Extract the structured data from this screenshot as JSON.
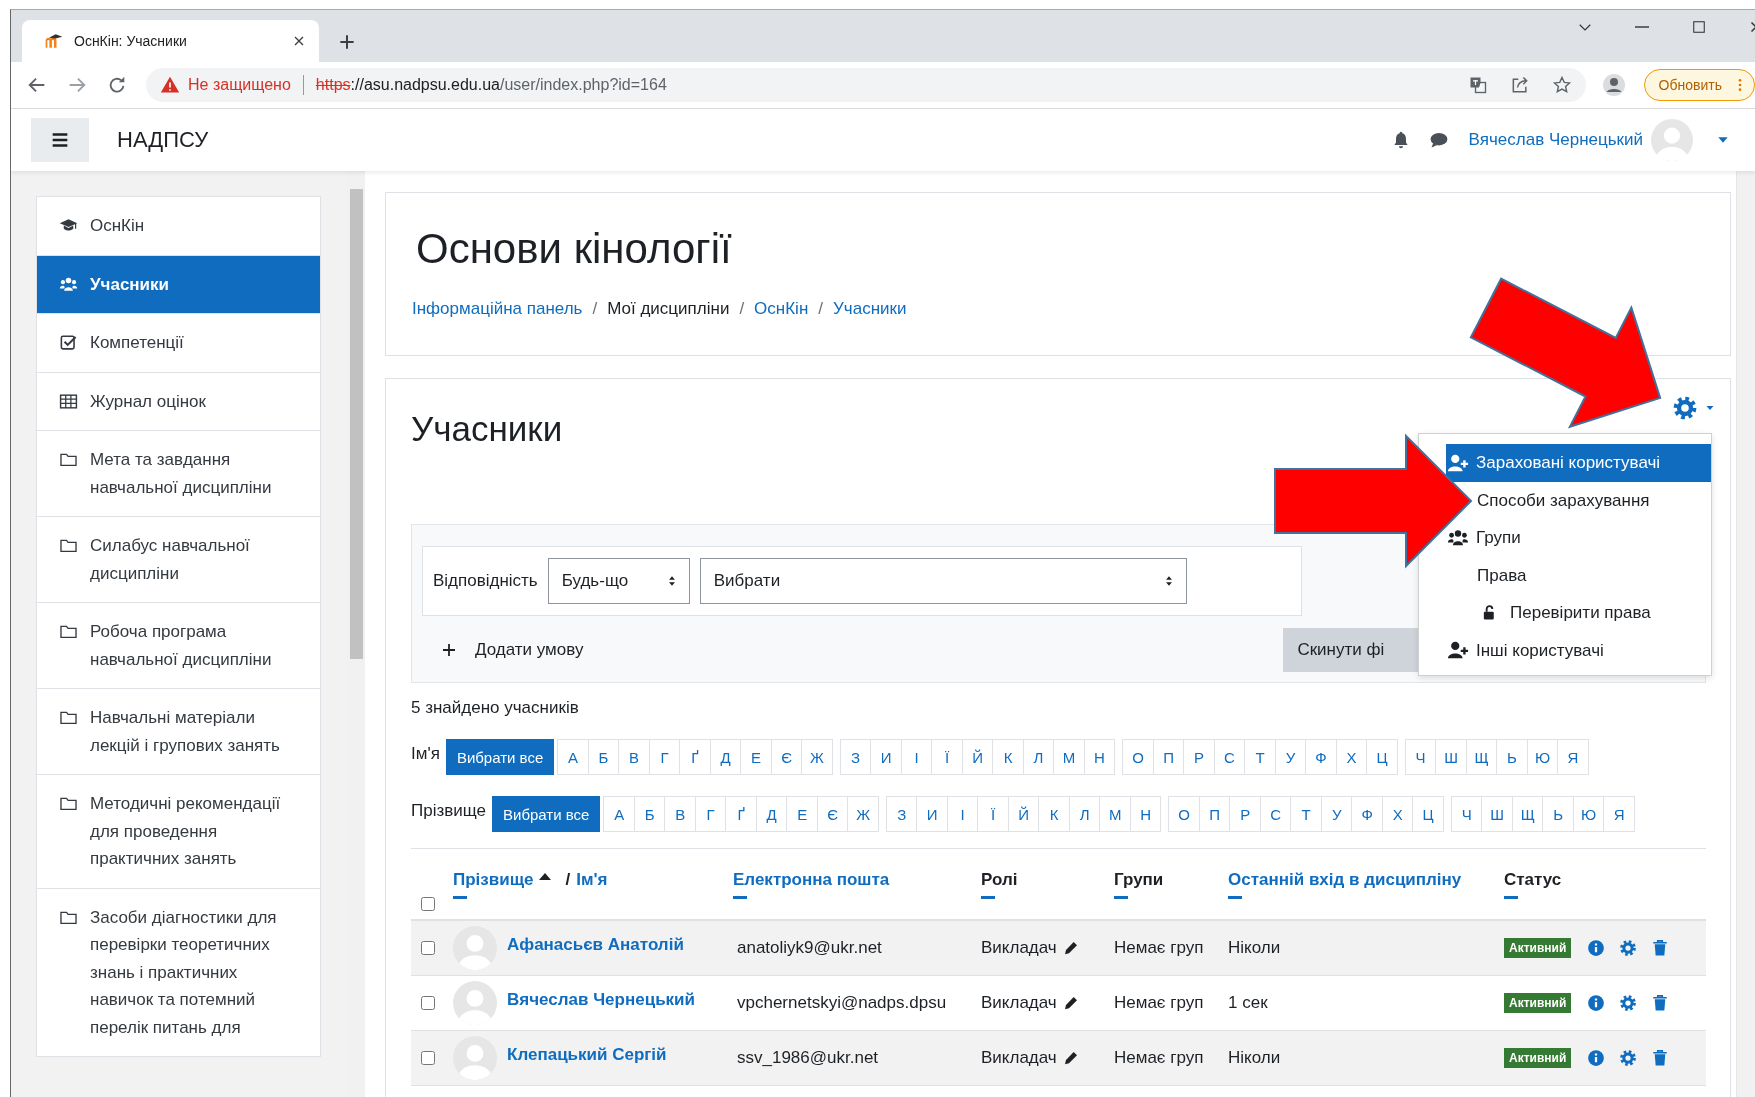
{
  "browser": {
    "tab_title": "ОснКін: Учасники",
    "address": {
      "warning": "Не защищено",
      "scheme": "https",
      "host": "://asu.nadpsu.edu.ua",
      "path": "/user/index.php?id=164"
    },
    "update_button": "Обновить"
  },
  "navbar": {
    "site_name": "НАДПСУ",
    "user_name": "Вячеслав Чернецький"
  },
  "sidebar": {
    "items": [
      {
        "label": "ОснКін",
        "kind": "course",
        "selected": false
      },
      {
        "label": "Учасники",
        "kind": "users",
        "selected": true
      },
      {
        "label": "Компетенції",
        "kind": "check",
        "selected": false
      },
      {
        "label": "Журнал оцінок",
        "kind": "table",
        "selected": false
      },
      {
        "label": "Мета та завдання навчальної дисципліни",
        "kind": "folder",
        "selected": false
      },
      {
        "label": "Силабус навчальної дисципліни",
        "kind": "folder",
        "selected": false
      },
      {
        "label": "Робоча програма навчальної дисципліни",
        "kind": "folder",
        "selected": false
      },
      {
        "label": "Навчальні матеріали лекцій і групових занять",
        "kind": "folder",
        "selected": false
      },
      {
        "label": "Методичні рекомендації для проведення практичних занять",
        "kind": "folder",
        "selected": false
      },
      {
        "label": "Засоби діагностики для перевірки теоретичних знань і практичних навичок та потемний перелік питань для",
        "kind": "folder",
        "selected": false
      }
    ]
  },
  "header": {
    "title": "Основи кінології",
    "breadcrumb": [
      {
        "label": "Інформаційна панель",
        "link": true
      },
      {
        "label": "Мої дисципліни",
        "link": false,
        "separator": "/"
      },
      {
        "label": "ОснКін",
        "link": true,
        "separator": "/"
      },
      {
        "label": "Учасники",
        "link": true,
        "separator": "/"
      }
    ]
  },
  "participants": {
    "heading": "Учасники",
    "settings_menu": {
      "expanded": true,
      "items": [
        {
          "label": "Зараховані користувачі",
          "kind": "adduser",
          "selected": true
        },
        {
          "label": "Способи зарахування",
          "kind": "none",
          "selected": false
        },
        {
          "label": "Групи",
          "kind": "group",
          "selected": false
        },
        {
          "label": "Права",
          "kind": "none",
          "selected": false
        },
        {
          "label": "Перевірити права",
          "kind": "lock",
          "selected": false
        },
        {
          "label": "Інші користувачі",
          "kind": "adduser",
          "selected": false
        }
      ]
    },
    "filter": {
      "match_label": "Відповідність",
      "match_value": "Будь-що",
      "condition_value": "Вибрати",
      "add_condition": "Додати умову",
      "reset_button": "Скинути фі"
    },
    "count_text": "5 знайдено учасників",
    "initials": [
      {
        "label": "Ім'я",
        "all": {
          "label": "Вибрати все",
          "selected": true
        },
        "letter_groups": [
          [
            {
              "label": "А",
              "selected": false
            },
            {
              "label": "Б",
              "selected": false
            },
            {
              "label": "В",
              "selected": false
            },
            {
              "label": "Г",
              "selected": false
            },
            {
              "label": "Ґ",
              "selected": false
            },
            {
              "label": "Д",
              "selected": false
            },
            {
              "label": "Е",
              "selected": false
            },
            {
              "label": "Є",
              "selected": false
            },
            {
              "label": "Ж",
              "selected": false
            }
          ],
          [
            {
              "label": "З",
              "selected": false
            },
            {
              "label": "И",
              "selected": false
            },
            {
              "label": "І",
              "selected": false
            },
            {
              "label": "Ї",
              "selected": false
            },
            {
              "label": "Й",
              "selected": false
            },
            {
              "label": "К",
              "selected": false
            },
            {
              "label": "Л",
              "selected": false
            },
            {
              "label": "М",
              "selected": false
            },
            {
              "label": "Н",
              "selected": false
            }
          ],
          [
            {
              "label": "О",
              "selected": false
            },
            {
              "label": "П",
              "selected": false
            },
            {
              "label": "Р",
              "selected": false
            },
            {
              "label": "С",
              "selected": false
            },
            {
              "label": "Т",
              "selected": false
            },
            {
              "label": "У",
              "selected": false
            },
            {
              "label": "Ф",
              "selected": false
            },
            {
              "label": "Х",
              "selected": false
            },
            {
              "label": "Ц",
              "selected": false
            }
          ],
          [
            {
              "label": "Ч",
              "selected": false
            },
            {
              "label": "Ш",
              "selected": false
            },
            {
              "label": "Щ",
              "selected": false
            },
            {
              "label": "Ь",
              "selected": false
            },
            {
              "label": "Ю",
              "selected": false
            },
            {
              "label": "Я",
              "selected": false
            }
          ]
        ]
      },
      {
        "label": "Прізвище",
        "all": {
          "label": "Вибрати все",
          "selected": true
        },
        "letter_groups": [
          [
            {
              "label": "А",
              "selected": false
            },
            {
              "label": "Б",
              "selected": false
            },
            {
              "label": "В",
              "selected": false
            },
            {
              "label": "Г",
              "selected": false
            },
            {
              "label": "Ґ",
              "selected": false
            },
            {
              "label": "Д",
              "selected": false
            },
            {
              "label": "Е",
              "selected": false
            },
            {
              "label": "Є",
              "selected": false
            },
            {
              "label": "Ж",
              "selected": false
            }
          ],
          [
            {
              "label": "З",
              "selected": false
            },
            {
              "label": "И",
              "selected": false
            },
            {
              "label": "І",
              "selected": false
            },
            {
              "label": "Ї",
              "selected": false
            },
            {
              "label": "Й",
              "selected": false
            },
            {
              "label": "К",
              "selected": false
            },
            {
              "label": "Л",
              "selected": false
            },
            {
              "label": "М",
              "selected": false
            },
            {
              "label": "Н",
              "selected": false
            }
          ],
          [
            {
              "label": "О",
              "selected": false
            },
            {
              "label": "П",
              "selected": false
            },
            {
              "label": "Р",
              "selected": false
            },
            {
              "label": "С",
              "selected": false
            },
            {
              "label": "Т",
              "selected": false
            },
            {
              "label": "У",
              "selected": false
            },
            {
              "label": "Ф",
              "selected": false
            },
            {
              "label": "Х",
              "selected": false
            },
            {
              "label": "Ц",
              "selected": false
            }
          ],
          [
            {
              "label": "Ч",
              "selected": false
            },
            {
              "label": "Ш",
              "selected": false
            },
            {
              "label": "Щ",
              "selected": false
            },
            {
              "label": "Ь",
              "selected": false
            },
            {
              "label": "Ю",
              "selected": false
            },
            {
              "label": "Я",
              "selected": false
            }
          ]
        ]
      }
    ],
    "table": {
      "select_all_checked": false,
      "columns": [
        {
          "kind": "name",
          "label": "Прізвище",
          "sorted": true,
          "separator": "/",
          "second_label": "Ім'я"
        },
        {
          "kind": "text",
          "label": "Електронна пошта",
          "link": true
        },
        {
          "kind": "text",
          "label": "Ролі",
          "link": false
        },
        {
          "kind": "text",
          "label": "Групи",
          "link": false
        },
        {
          "kind": "text",
          "label": "Останній вхід в дисципліну",
          "link": true
        },
        {
          "kind": "text",
          "label": "Статус",
          "link": false
        }
      ],
      "rows": [
        {
          "checked": false,
          "name": "Афанасьєв Анатолій",
          "email": "anatoliyk9@ukr.net",
          "role": "Викладач",
          "groups": "Немає груп",
          "last_access": "Ніколи",
          "status": "Активний"
        },
        {
          "checked": false,
          "name": "Вячеслав Чернецький",
          "email": "vpchernetskyi@nadps.dpsu",
          "role": "Викладач",
          "groups": "Немає груп",
          "last_access": "1 сек",
          "status": "Активний"
        },
        {
          "checked": false,
          "name": "Клепацький Сергій",
          "email": "ssv_1986@ukr.net",
          "role": "Викладач",
          "groups": "Немає груп",
          "last_access": "Ніколи",
          "status": "Активний"
        }
      ]
    }
  }
}
